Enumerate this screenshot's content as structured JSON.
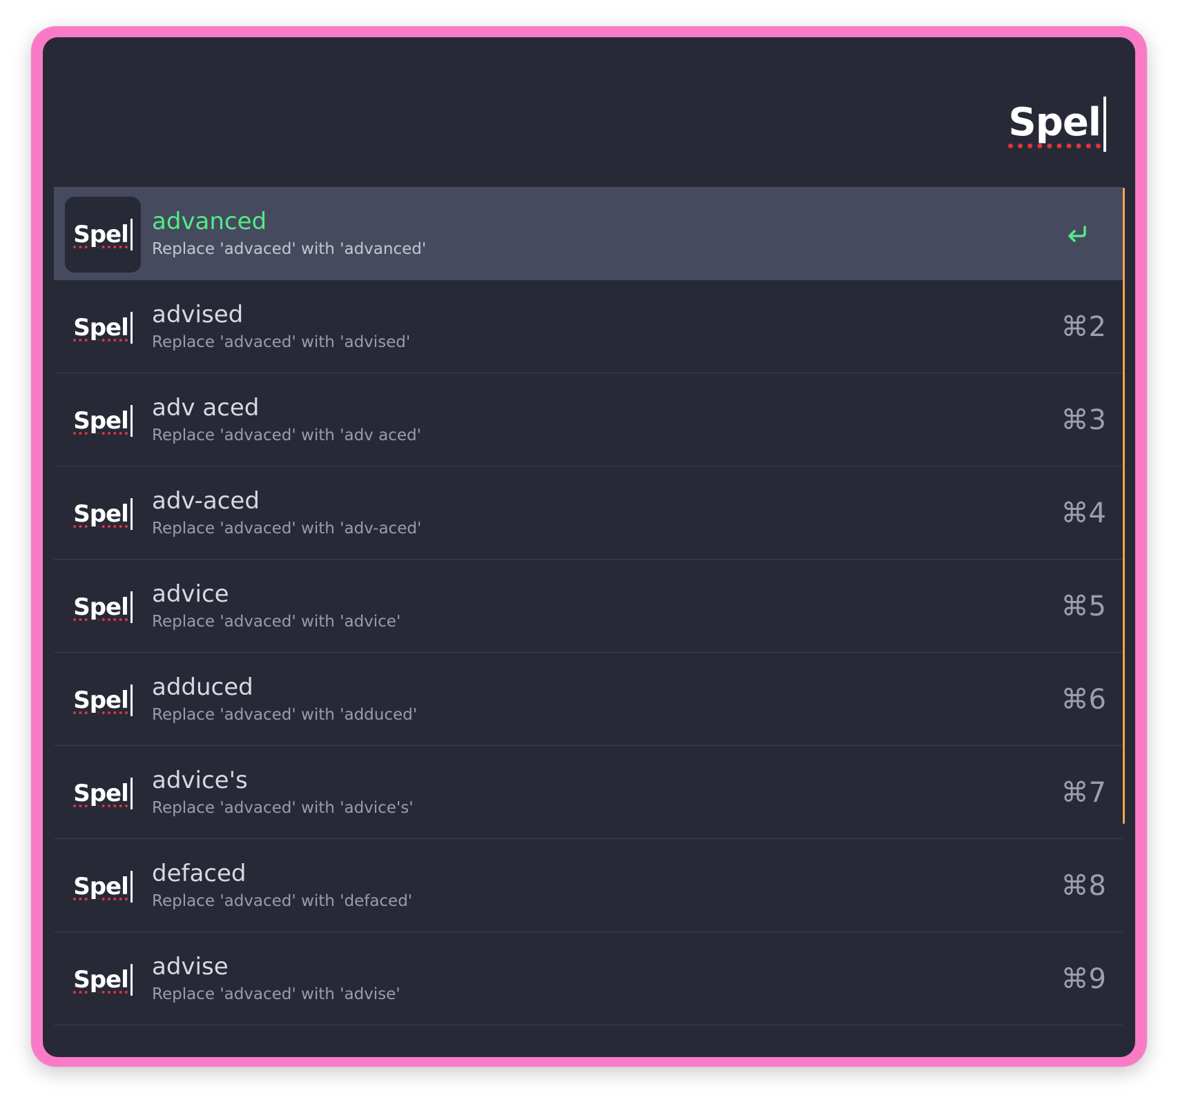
{
  "query": {
    "text": "Spel"
  },
  "results": [
    {
      "title": "advanced",
      "subtitle": "Replace 'advaced' with 'advanced'",
      "icon_label": "Spel",
      "shortcut": "",
      "selected": true
    },
    {
      "title": "advised",
      "subtitle": "Replace 'advaced' with 'advised'",
      "icon_label": "Spel",
      "shortcut": "⌘2"
    },
    {
      "title": "adv aced",
      "subtitle": "Replace 'advaced' with 'adv aced'",
      "icon_label": "Spel",
      "shortcut": "⌘3"
    },
    {
      "title": "adv-aced",
      "subtitle": "Replace 'advaced' with 'adv-aced'",
      "icon_label": "Spel",
      "shortcut": "⌘4"
    },
    {
      "title": "advice",
      "subtitle": "Replace 'advaced' with 'advice'",
      "icon_label": "Spel",
      "shortcut": "⌘5"
    },
    {
      "title": "adduced",
      "subtitle": "Replace 'advaced' with 'adduced'",
      "icon_label": "Spel",
      "shortcut": "⌘6"
    },
    {
      "title": "advice's",
      "subtitle": "Replace 'advaced' with 'advice's'",
      "icon_label": "Spel",
      "shortcut": "⌘7"
    },
    {
      "title": "defaced",
      "subtitle": "Replace 'advaced' with 'defaced'",
      "icon_label": "Spel",
      "shortcut": "⌘8"
    },
    {
      "title": "advise",
      "subtitle": "Replace 'advaced' with 'advise'",
      "icon_label": "Spel",
      "shortcut": "⌘9"
    }
  ],
  "icons": {
    "selected_action": "return-icon",
    "result_icon": "spell-icon"
  },
  "colors": {
    "frame_border": "#f97bc7",
    "background": "#272937",
    "selected_row": "#464a5e",
    "selected_title": "#52eb87",
    "spell_underline": "#e0353d",
    "scrollbar": "#f2a64a"
  }
}
